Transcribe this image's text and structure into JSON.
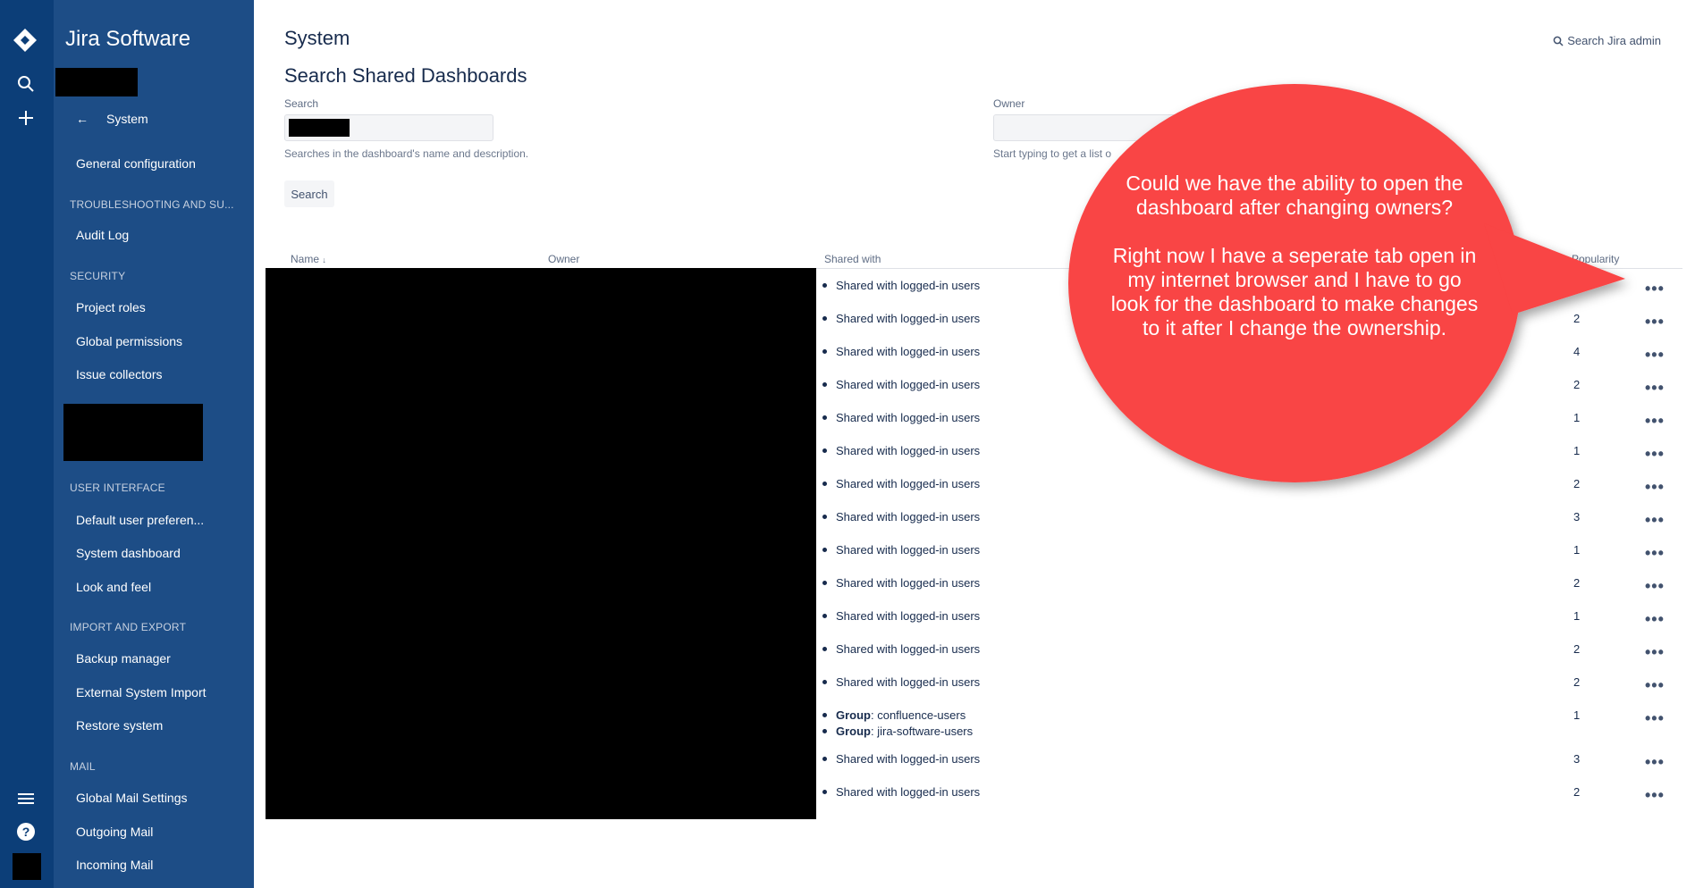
{
  "app": {
    "product_name": "Jira Software"
  },
  "global_nav": {
    "icons": [
      "jira-logo-icon",
      "search-icon",
      "plus-icon",
      "menu-icon",
      "help-icon"
    ]
  },
  "sidebar": {
    "back_label": "System",
    "general_configuration": "General configuration",
    "sections": {
      "troubleshooting": "TROUBLESHOOTING AND SU...",
      "security": "SECURITY",
      "user_interface": "USER INTERFACE",
      "import_export": "IMPORT AND EXPORT",
      "mail": "MAIL"
    },
    "items": {
      "audit_log": "Audit Log",
      "project_roles": "Project roles",
      "global_permissions": "Global permissions",
      "issue_collectors": "Issue collectors",
      "default_user_prefs": "Default user preferen...",
      "system_dashboard": "System dashboard",
      "look_and_feel": "Look and feel",
      "backup_manager": "Backup manager",
      "external_system_import": "External System Import",
      "restore_system": "Restore system",
      "global_mail_settings": "Global Mail Settings",
      "outgoing_mail": "Outgoing Mail",
      "incoming_mail": "Incoming Mail"
    }
  },
  "header": {
    "page_title": "System",
    "search_admin": "Search Jira admin"
  },
  "form": {
    "title": "Search Shared Dashboards",
    "search_label": "Search",
    "search_help": "Searches in the dashboard's name and description.",
    "owner_label": "Owner",
    "owner_help": "Start typing to get a list o",
    "search_button": "Search"
  },
  "table": {
    "headers": {
      "name": "Name",
      "sort_arrow": "↓",
      "owner": "Owner",
      "shared_with": "Shared with",
      "popularity": "Popularity"
    },
    "rows": [
      {
        "shared": [
          "Shared with logged-in users"
        ],
        "popularity": ""
      },
      {
        "shared": [
          "Shared with logged-in users"
        ],
        "popularity": "2"
      },
      {
        "shared": [
          "Shared with logged-in users"
        ],
        "popularity": "4"
      },
      {
        "shared": [
          "Shared with logged-in users"
        ],
        "popularity": "2"
      },
      {
        "shared": [
          "Shared with logged-in users"
        ],
        "popularity": "1"
      },
      {
        "shared": [
          "Shared with logged-in users"
        ],
        "popularity": "1"
      },
      {
        "shared": [
          "Shared with logged-in users"
        ],
        "popularity": "2"
      },
      {
        "shared": [
          "Shared with logged-in users"
        ],
        "popularity": "3"
      },
      {
        "shared": [
          "Shared with logged-in users"
        ],
        "popularity": "1"
      },
      {
        "shared": [
          "Shared with logged-in users"
        ],
        "popularity": "2"
      },
      {
        "shared": [
          "Shared with logged-in users"
        ],
        "popularity": "1"
      },
      {
        "shared": [
          "Shared with logged-in users"
        ],
        "popularity": "2"
      },
      {
        "shared": [
          "Shared with logged-in users"
        ],
        "popularity": "2"
      },
      {
        "shared": [
          {
            "label": "Group",
            "value": ": confluence-users"
          },
          {
            "label": "Group",
            "value": ": jira-software-users"
          }
        ],
        "popularity": "1"
      },
      {
        "shared": [
          "Shared with logged-in users"
        ],
        "popularity": "3"
      },
      {
        "shared": [
          "Shared with logged-in users"
        ],
        "popularity": "2"
      }
    ],
    "more_label": "•••"
  },
  "callout": {
    "line1": "Could we have the ability to open the dashboard after changing owners?",
    "line2": "Right now I have a seperate tab open in my internet browser and I have to go look for the dashboard to make changes to it after I change the ownership."
  },
  "colors": {
    "nav": "#0c3e78",
    "sidebar": "#1d4d86",
    "callout": "#f94444"
  }
}
